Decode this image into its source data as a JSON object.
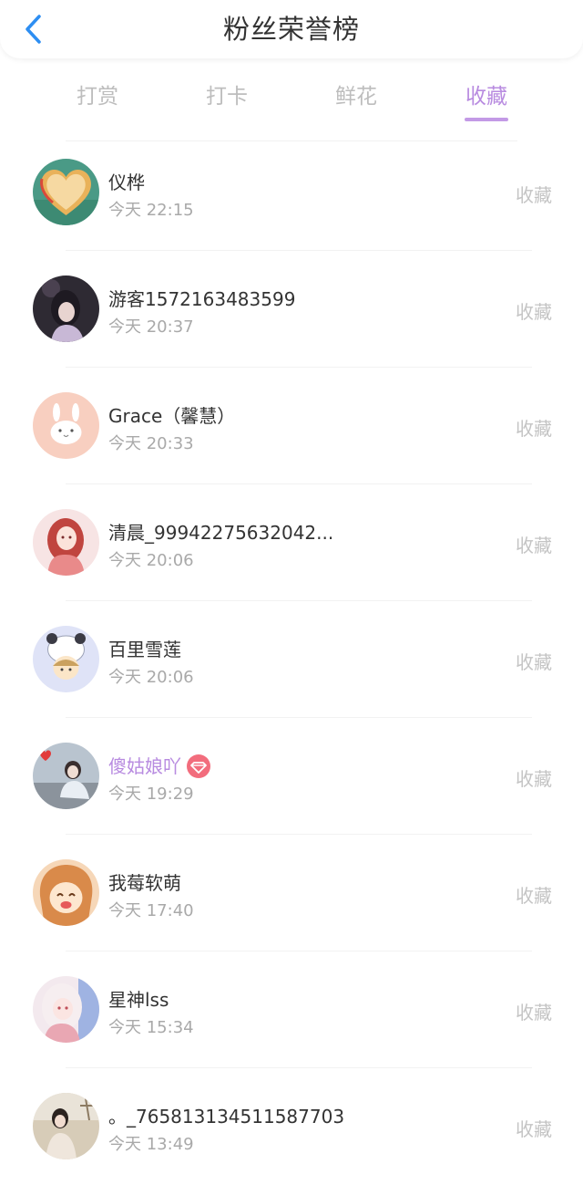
{
  "header": {
    "title": "粉丝荣誉榜",
    "back_icon": "chevron-left-icon",
    "accent_color": "#2d8ef2"
  },
  "tabs": [
    {
      "label": "打赏",
      "active": false
    },
    {
      "label": "打卡",
      "active": false
    },
    {
      "label": "鲜花",
      "active": false
    },
    {
      "label": "收藏",
      "active": true
    }
  ],
  "colors": {
    "active_tab": "#b88be0",
    "inactive_tab": "#bdbdbd",
    "vip_name": "#b88be0",
    "badge": "#f26d7d"
  },
  "fans": [
    {
      "name": "仪桦",
      "time": "今天 22:15",
      "action": "收藏",
      "avatar": "heart-avatar-icon",
      "vip": false
    },
    {
      "name": "游客1572163483599",
      "time": "今天 20:37",
      "action": "收藏",
      "avatar": "girl-dark-avatar-icon",
      "vip": false
    },
    {
      "name": "Grace（馨慧）",
      "time": "今天 20:33",
      "action": "收藏",
      "avatar": "bunny-avatar-icon",
      "vip": false
    },
    {
      "name": "清晨_99942275632042...",
      "time": "今天 20:06",
      "action": "收藏",
      "avatar": "red-hair-girl-avatar-icon",
      "vip": false
    },
    {
      "name": "百里雪莲",
      "time": "今天 20:06",
      "action": "收藏",
      "avatar": "panda-hat-avatar-icon",
      "vip": false
    },
    {
      "name": "傻姑娘吖",
      "time": "今天 19:29",
      "action": "收藏",
      "avatar": "photo-girl-avatar-icon",
      "vip": true,
      "badge_icon": "diamond-icon"
    },
    {
      "name": "我莓软萌",
      "time": "今天 17:40",
      "action": "收藏",
      "avatar": "anime-girl-avatar-icon",
      "vip": false
    },
    {
      "name": "星神lss",
      "time": "今天 15:34",
      "action": "收藏",
      "avatar": "white-hair-avatar-icon",
      "vip": false
    },
    {
      "name": "。_765813134511587703",
      "time": "今天 13:49",
      "action": "收藏",
      "avatar": "outdoor-girl-avatar-icon",
      "vip": false
    }
  ]
}
